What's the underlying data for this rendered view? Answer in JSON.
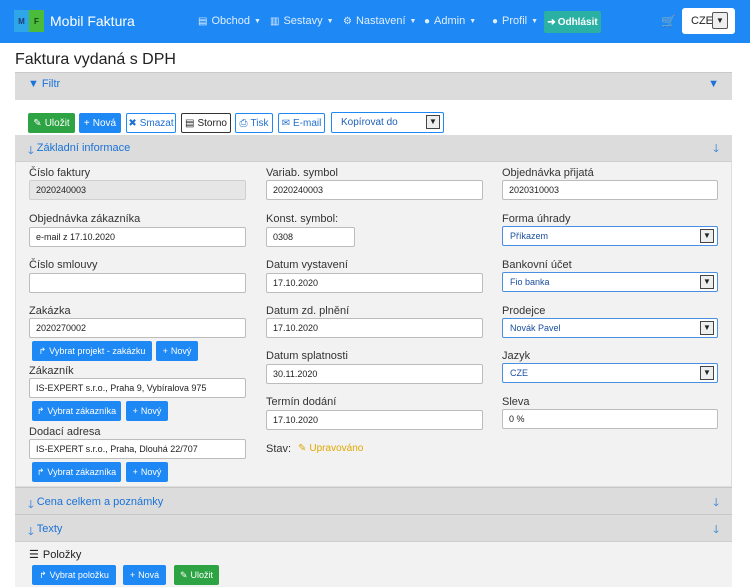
{
  "navbar": {
    "logo_left": "M",
    "logo_right": "F",
    "brand": "Mobil Faktura",
    "items": [
      {
        "label": "Obchod",
        "icon": "document-icon"
      },
      {
        "label": "Sestavy",
        "icon": "bar-chart-icon"
      },
      {
        "label": "Nastavení",
        "icon": "gear-icon"
      },
      {
        "label": "Admin",
        "icon": "user-circle-icon"
      },
      {
        "label": "Profil",
        "icon": "user-icon"
      }
    ],
    "logout": "Odhlásit",
    "language": "CZE"
  },
  "page_title": "Faktura vydaná s DPH",
  "filter": {
    "label": "Filtr"
  },
  "toolbar": {
    "save": "Uložit",
    "new": "Nová",
    "delete": "Smazat",
    "storno": "Storno",
    "print": "Tisk",
    "email": "E-mail",
    "copy_to": "Kopírovat do"
  },
  "basic_info": {
    "title": "Základní informace",
    "col1": {
      "invoice_number_label": "Číslo faktury",
      "invoice_number": "2020240003",
      "customer_order_label": "Objednávka zákazníka",
      "customer_order": "e-mail z 17.10.2020",
      "contract_label": "Číslo smlouvy",
      "contract": "",
      "project_label": "Zakázka",
      "project": "2020270002",
      "select_project": "Vybrat projekt - zakázku",
      "new_project": "Nový",
      "customer_label": "Zákazník",
      "customer": "IS-EXPERT s.r.o., Praha 9, Vybíralova 975",
      "select_customer": "Vybrat zákazníka",
      "new_customer": "Nový",
      "delivery_label": "Dodací adresa",
      "delivery": "IS-EXPERT s.r.o., Praha, Dlouhá 22/707",
      "select_delivery": "Vybrat zákazníka",
      "new_delivery": "Nový"
    },
    "col2": {
      "var_symbol_label": "Variab. symbol",
      "var_symbol": "2020240003",
      "const_symbol_label": "Konst. symbol:",
      "const_symbol": "0308",
      "issue_date_label": "Datum vystavení",
      "issue_date": "17.10.2020",
      "tax_date_label": "Datum zd. plnění",
      "tax_date": "17.10.2020",
      "due_date_label": "Datum splatnosti",
      "due_date": "30.11.2020",
      "delivery_date_label": "Termín dodání",
      "delivery_date": "17.10.2020",
      "status_label": "Stav:",
      "status": "Upravováno"
    },
    "col3": {
      "received_order_label": "Objednávka přijatá",
      "received_order": "2020310003",
      "payment_label": "Forma úhrady",
      "payment": "Příkazem",
      "bank_label": "Bankovní účet",
      "bank": "Fio banka",
      "seller_label": "Prodejce",
      "seller": "Novák Pavel",
      "language_label": "Jazyk",
      "language": "CZE",
      "discount_label": "Sleva",
      "discount": "0 %"
    }
  },
  "sections": {
    "total": "Cena celkem a poznámky",
    "texts": "Texty"
  },
  "items": {
    "title": "Položky",
    "select": "Vybrat položku",
    "new": "Nová",
    "save": "Uložit"
  },
  "colors": {
    "navbar": "#1e88f5",
    "logout": "#2bb0a4",
    "green": "#2da344",
    "status": "#e0a800"
  }
}
